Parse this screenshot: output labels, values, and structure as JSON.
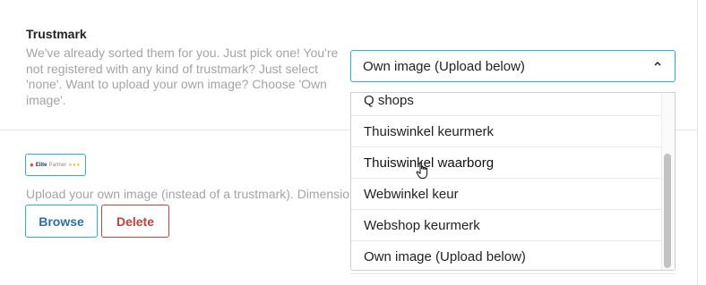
{
  "trustmark": {
    "label": "Trustmark",
    "help": "We've already sorted them for you. Just pick one! You're not registered with any kind of trustmark? Just select 'none'. Want to upload your own image? Choose 'Own image'.",
    "selected": "Own image (Upload below)",
    "chevron_icon": "chevron-up-icon",
    "options": [
      "Q shops",
      "Thuiswinkel keurmerk",
      "Thuiswinkel waarborg",
      "Webwinkel keur",
      "Webshop keurmerk",
      "Own image (Upload below)"
    ]
  },
  "upload": {
    "logo_brand": "Elite",
    "logo_sub": "Partner",
    "logo_stars": "★★★",
    "help": "Upload your own image (instead of a trustmark). Dimension",
    "browse_label": "Browse",
    "delete_label": "Delete"
  },
  "colors": {
    "accent": "#2aaed5",
    "danger": "#c1423d",
    "muted_text": "#a4a4a4"
  }
}
